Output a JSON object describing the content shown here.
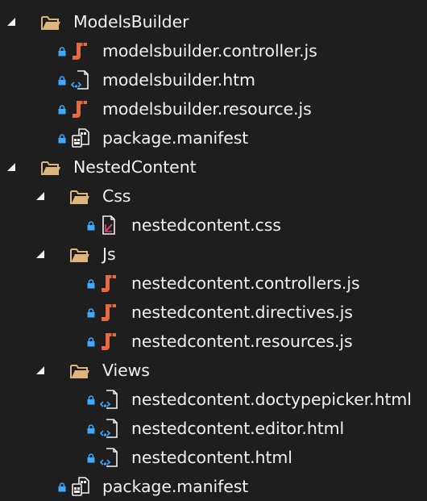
{
  "tree": {
    "items": [
      {
        "label": "ModelsBuilder",
        "type": "folder",
        "expanded": true,
        "locked": false,
        "icon": "folder-icon"
      },
      {
        "label": "modelsbuilder.controller.js",
        "type": "js",
        "locked": true,
        "icon": "js-file-icon"
      },
      {
        "label": "modelsbuilder.htm",
        "type": "html",
        "locked": true,
        "icon": "html-file-icon"
      },
      {
        "label": "modelsbuilder.resource.js",
        "type": "js",
        "locked": true,
        "icon": "js-file-icon"
      },
      {
        "label": "package.manifest",
        "type": "manifest",
        "locked": true,
        "icon": "manifest-file-icon"
      },
      {
        "label": "NestedContent",
        "type": "folder",
        "expanded": true,
        "locked": false,
        "icon": "folder-icon"
      },
      {
        "label": "Css",
        "type": "folder",
        "expanded": true,
        "locked": false,
        "icon": "folder-icon"
      },
      {
        "label": "nestedcontent.css",
        "type": "css",
        "locked": true,
        "icon": "css-file-icon"
      },
      {
        "label": "Js",
        "type": "folder",
        "expanded": true,
        "locked": false,
        "icon": "folder-icon"
      },
      {
        "label": "nestedcontent.controllers.js",
        "type": "js",
        "locked": true,
        "icon": "js-file-icon"
      },
      {
        "label": "nestedcontent.directives.js",
        "type": "js",
        "locked": true,
        "icon": "js-file-icon"
      },
      {
        "label": "nestedcontent.resources.js",
        "type": "js",
        "locked": true,
        "icon": "js-file-icon"
      },
      {
        "label": "Views",
        "type": "folder",
        "expanded": true,
        "locked": false,
        "icon": "folder-icon"
      },
      {
        "label": "nestedcontent.doctypepicker.html",
        "type": "html",
        "locked": true,
        "icon": "html-file-icon"
      },
      {
        "label": "nestedcontent.editor.html",
        "type": "html",
        "locked": true,
        "icon": "html-file-icon"
      },
      {
        "label": "nestedcontent.html",
        "type": "html",
        "locked": true,
        "icon": "html-file-icon"
      },
      {
        "label": "package.manifest",
        "type": "manifest",
        "locked": true,
        "icon": "manifest-file-icon"
      }
    ]
  },
  "colors": {
    "background": "#1e1e1e",
    "text": "#f1f1f1",
    "folder": "#dcb67a",
    "js": "#e8693f",
    "lock": "#3ea8ff",
    "file_outline": "#f1f1f1",
    "css_accent": "#e0457b"
  }
}
